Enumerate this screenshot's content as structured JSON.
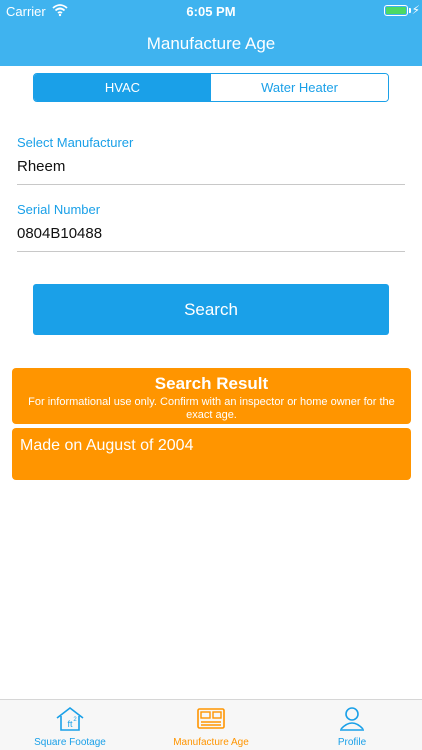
{
  "status_bar": {
    "carrier": "Carrier",
    "time": "6:05 PM",
    "bolt": "⚡"
  },
  "nav": {
    "title": "Manufacture Age"
  },
  "segments": {
    "left": "HVAC",
    "right": "Water Heater",
    "selected": "HVAC"
  },
  "form": {
    "manufacturer_label": "Select Manufacturer",
    "manufacturer_value": "Rheem",
    "serial_label": "Serial Number",
    "serial_value": "0804B10488"
  },
  "search": {
    "label": "Search"
  },
  "result": {
    "title": "Search Result",
    "disclaimer": "For informational use only. Confirm with an inspector or home owner for the exact age.",
    "text": "Made on August of 2004"
  },
  "tabs": [
    {
      "label": "Square Footage",
      "icon": "house-ft2-icon",
      "active": false
    },
    {
      "label": "Manufacture Age",
      "icon": "appliance-icon",
      "active": true
    },
    {
      "label": "Profile",
      "icon": "profile-icon",
      "active": false
    }
  ],
  "colors": {
    "header": "#3fb3ef",
    "accent": "#1aa0e8",
    "result": "#ff9500",
    "battery": "#4cd964"
  }
}
